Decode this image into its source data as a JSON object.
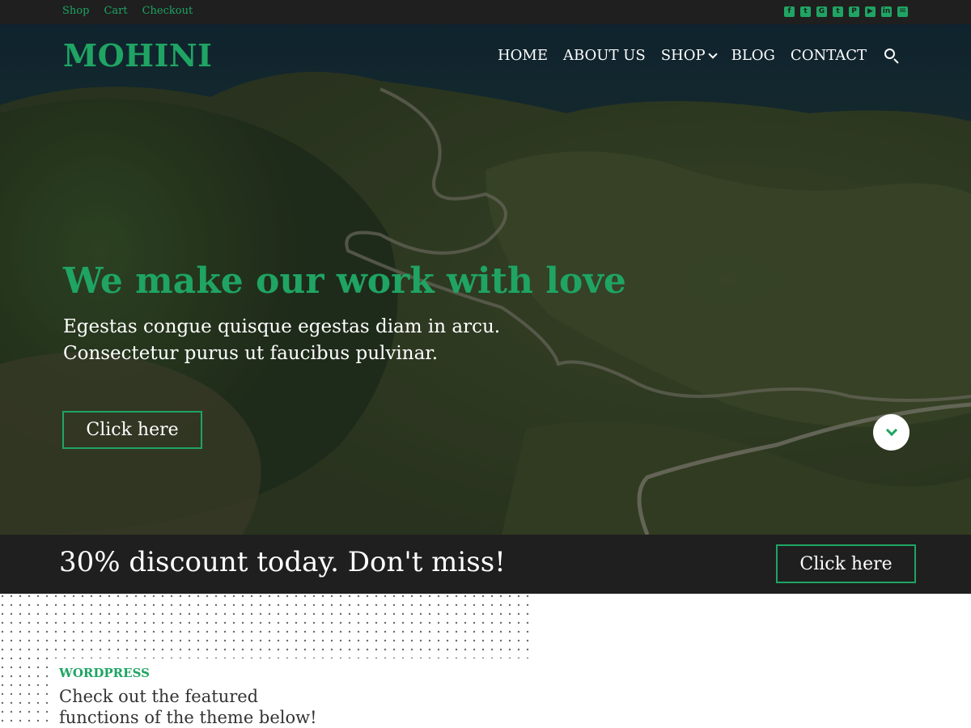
{
  "topbar": {
    "links": [
      "Shop",
      "Cart",
      "Checkout"
    ],
    "social_icons": [
      "facebook-icon",
      "twitter-icon",
      "google-icon",
      "tumblr-icon",
      "pinterest-icon",
      "youtube-icon",
      "linkedin-icon",
      "email-icon"
    ]
  },
  "header": {
    "brand": "MOHINI",
    "nav": [
      "HOME",
      "ABOUT US",
      "SHOP",
      "BLOG",
      "CONTACT"
    ]
  },
  "hero": {
    "headline": "We make our work with love",
    "subtext_line1": "Egestas congue quisque egestas diam in arcu.",
    "subtext_line2": "Consectetur purus ut faucibus pulvinar.",
    "cta": "Click here"
  },
  "discount": {
    "text": "30% discount today. Don't miss!",
    "cta": "Click here"
  },
  "featured": {
    "kicker": "WORDPRESS",
    "title_line1": "Check out the featured",
    "title_line2": "functions of the theme below!"
  },
  "colors": {
    "accent": "#1fa463",
    "dark": "#1f1f1f",
    "white": "#ffffff"
  }
}
